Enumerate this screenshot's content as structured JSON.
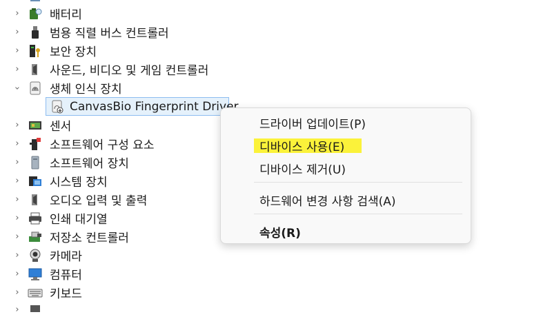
{
  "tree": {
    "items": [
      {
        "label": "배터리",
        "icon": "battery-icon",
        "expanded": false
      },
      {
        "label": "범용 직렬 버스 컨트롤러",
        "icon": "usb-icon",
        "expanded": false
      },
      {
        "label": "보안 장치",
        "icon": "security-device-icon",
        "expanded": false
      },
      {
        "label": "사운드, 비디오 및 게임 컨트롤러",
        "icon": "speaker-icon",
        "expanded": false
      },
      {
        "label": "생체 인식 장치",
        "icon": "biometric-icon",
        "expanded": true
      },
      {
        "label": "CanvasBio Fingerprint Driver",
        "icon": "fingerprint-icon",
        "child": true
      },
      {
        "label": "센서",
        "icon": "sensor-icon",
        "expanded": false
      },
      {
        "label": "소프트웨어 구성 요소",
        "icon": "software-component-icon",
        "expanded": false
      },
      {
        "label": "소프트웨어 장치",
        "icon": "software-device-icon",
        "expanded": false
      },
      {
        "label": "시스템 장치",
        "icon": "system-device-icon",
        "expanded": false
      },
      {
        "label": "오디오 입력 및 출력",
        "icon": "audio-io-icon",
        "expanded": false
      },
      {
        "label": "인쇄 대기열",
        "icon": "printer-icon",
        "expanded": false
      },
      {
        "label": "저장소 컨트롤러",
        "icon": "storage-controller-icon",
        "expanded": false
      },
      {
        "label": "카메라",
        "icon": "camera-icon",
        "expanded": false
      },
      {
        "label": "컴퓨터",
        "icon": "computer-icon",
        "expanded": false
      },
      {
        "label": "키보드",
        "icon": "keyboard-icon",
        "expanded": false
      }
    ]
  },
  "context_menu": {
    "update_driver": "드라이버 업데이트(P)",
    "enable_device": "디바이스 사용(E)",
    "uninstall_device": "디바이스 제거(U)",
    "scan_hardware": "하드웨어 변경 사항 검색(A)",
    "properties": "속성(R)"
  },
  "colors": {
    "highlight": "#fbf23a",
    "selection_border": "#8cbcf0",
    "selection_fill": "#e5f1fb"
  }
}
